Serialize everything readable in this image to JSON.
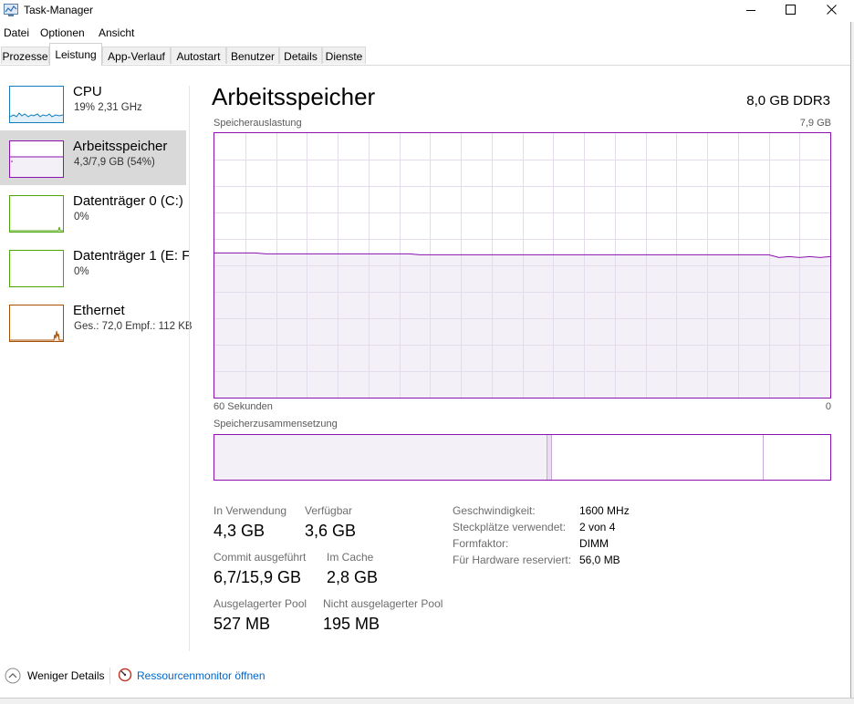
{
  "window": {
    "title": "Task-Manager"
  },
  "menu": [
    "Datei",
    "Optionen",
    "Ansicht"
  ],
  "tabs": [
    "Prozesse",
    "Leistung",
    "App-Verlauf",
    "Autostart",
    "Benutzer",
    "Details",
    "Dienste"
  ],
  "active_tab": "Leistung",
  "sidebar": {
    "items": [
      {
        "name": "CPU",
        "sub": "19% 2,31 GHz",
        "color": "#117dbb"
      },
      {
        "name": "Arbeitsspeicher",
        "sub": "4,3/7,9 GB (54%)",
        "color": "#8b12ae"
      },
      {
        "name": "Datenträger 0 (C:)",
        "sub": "0%",
        "color": "#4da60c"
      },
      {
        "name": "Datenträger 1 (E: F",
        "sub": "0%",
        "color": "#4da60c"
      },
      {
        "name": "Ethernet",
        "sub": "Ges.: 72,0  Empf.: 112 KB",
        "color": "#a74f01"
      }
    ]
  },
  "main": {
    "title": "Arbeitsspeicher",
    "spec": "8,0 GB DDR3",
    "usage_label": "Speicherauslastung",
    "usage_max": "7,9 GB",
    "time_left": "60 Sekunden",
    "time_right": "0",
    "composition_label": "Speicherzusammensetzung",
    "usage_fraction": 0.54,
    "stats": {
      "in_use_label": "In Verwendung",
      "in_use": "4,3 GB",
      "available_label": "Verfügbar",
      "available": "3,6 GB",
      "commit_label": "Commit ausgeführt",
      "commit": "6,7/15,9 GB",
      "cache_label": "Im Cache",
      "cache": "2,8 GB",
      "paged_label": "Ausgelagerter Pool",
      "paged": "527 MB",
      "nonpaged_label": "Nicht ausgelagerter Pool",
      "nonpaged": "195 MB"
    },
    "specs": [
      {
        "label": "Geschwindigkeit:",
        "value": "1600 MHz"
      },
      {
        "label": "Steckplätze verwendet:",
        "value": "2 von 4"
      },
      {
        "label": "Formfaktor:",
        "value": "DIMM"
      },
      {
        "label": "Für Hardware reserviert:",
        "value": "56,0 MB"
      }
    ]
  },
  "footer": {
    "fewer_details": "Weniger Details",
    "resmon": "Ressourcenmonitor öffnen"
  },
  "colors": {
    "memory": "#8b12ae",
    "link": "#0066cc"
  }
}
